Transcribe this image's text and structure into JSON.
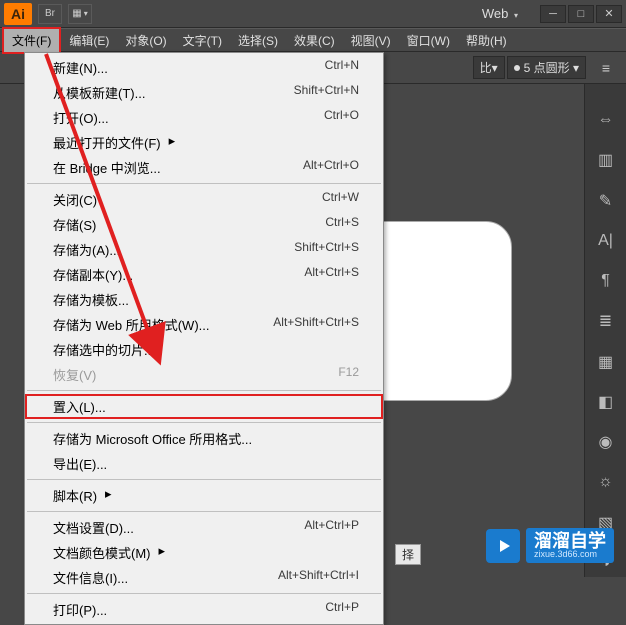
{
  "titlebar": {
    "logo": "Ai",
    "br_label": "Br",
    "web_label": "Web"
  },
  "menubar": {
    "items": [
      "文件(F)",
      "编辑(E)",
      "对象(O)",
      "文字(T)",
      "选择(S)",
      "效果(C)",
      "视图(V)",
      "窗口(W)",
      "帮助(H)"
    ]
  },
  "options": {
    "scale_frag": "比",
    "shape_label": "5 点圆形"
  },
  "dropdown": {
    "groups": [
      [
        {
          "label": "新建(N)...",
          "shortcut": "Ctrl+N"
        },
        {
          "label": "从模板新建(T)...",
          "shortcut": "Shift+Ctrl+N"
        },
        {
          "label": "打开(O)...",
          "shortcut": "Ctrl+O"
        },
        {
          "label": "最近打开的文件(F)",
          "shortcut": "",
          "submenu": true
        },
        {
          "label": "在 Bridge 中浏览...",
          "shortcut": "Alt+Ctrl+O"
        }
      ],
      [
        {
          "label": "关闭(C)",
          "shortcut": "Ctrl+W"
        },
        {
          "label": "存储(S)",
          "shortcut": "Ctrl+S"
        },
        {
          "label": "存储为(A)...",
          "shortcut": "Shift+Ctrl+S"
        },
        {
          "label": "存储副本(Y)...",
          "shortcut": "Alt+Ctrl+S"
        },
        {
          "label": "存储为模板...",
          "shortcut": ""
        },
        {
          "label": "存储为 Web 所用格式(W)...",
          "shortcut": "Alt+Shift+Ctrl+S"
        },
        {
          "label": "存储选中的切片...",
          "shortcut": ""
        },
        {
          "label": "恢复(V)",
          "shortcut": "F12",
          "disabled": true
        }
      ],
      [
        {
          "label": "置入(L)...",
          "shortcut": "",
          "highlighted": true
        }
      ],
      [
        {
          "label": "存储为 Microsoft Office 所用格式...",
          "shortcut": ""
        },
        {
          "label": "导出(E)...",
          "shortcut": ""
        }
      ],
      [
        {
          "label": "脚本(R)",
          "shortcut": "",
          "submenu": true
        }
      ],
      [
        {
          "label": "文档设置(D)...",
          "shortcut": "Alt+Ctrl+P"
        },
        {
          "label": "文档颜色模式(M)",
          "shortcut": "",
          "submenu": true
        },
        {
          "label": "文件信息(I)...",
          "shortcut": "Alt+Shift+Ctrl+I"
        }
      ],
      [
        {
          "label": "打印(P)...",
          "shortcut": "Ctrl+P"
        }
      ]
    ]
  },
  "status_frag": "择",
  "watermark": {
    "title": "溜溜自学",
    "url": "zixue.3d66.com"
  }
}
